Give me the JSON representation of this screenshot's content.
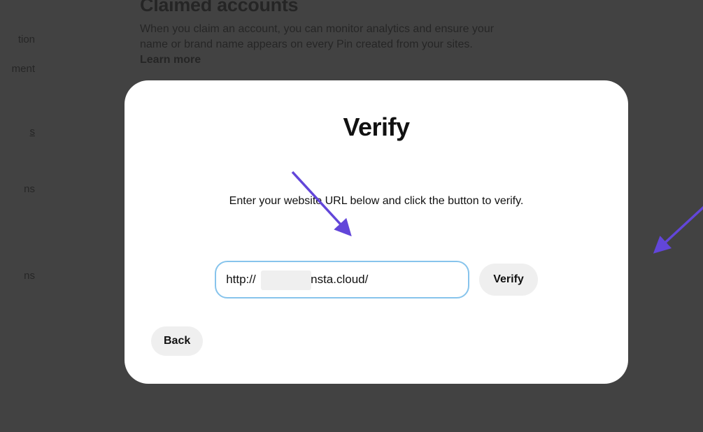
{
  "background": {
    "title": "Claimed accounts",
    "description_start": "When you claim an account, you can monitor analytics and ensure your name or brand name appears on every Pin created from your sites. ",
    "learn_more": "Learn more",
    "sidebar": {
      "item1": "tion",
      "item2": "ment",
      "item3": "s",
      "item4": "ns",
      "item5": "ns"
    }
  },
  "modal": {
    "title": "Verify",
    "subtitle": "Enter your website URL below and click the button to verify.",
    "url_value": "http://             .kinsta.cloud/",
    "verify_label": "Verify",
    "back_label": "Back"
  },
  "annotation_color": "#6246d9"
}
